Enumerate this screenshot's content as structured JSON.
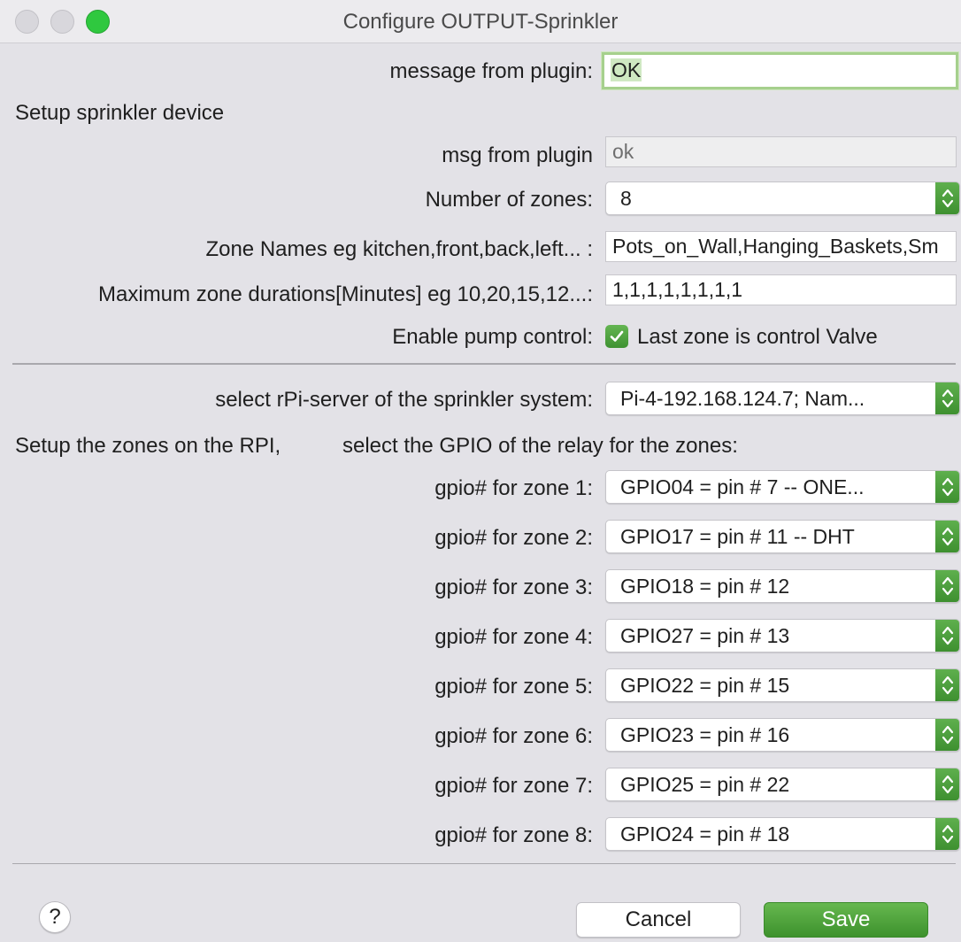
{
  "window": {
    "title": "Configure OUTPUT-Sprinkler"
  },
  "plugin_message": {
    "label": "message from plugin:",
    "value": "OK"
  },
  "setup_device": {
    "heading": "Setup sprinkler device"
  },
  "msg_from_plugin": {
    "label": "msg from plugin",
    "value": "ok"
  },
  "num_zones": {
    "label": "Number of zones:",
    "value": "8"
  },
  "zone_names": {
    "label": "Zone Names eg kitchen,front,back,left... :",
    "value": "Pots_on_Wall,Hanging_Baskets,Sm"
  },
  "max_durations": {
    "label": "Maximum zone durations[Minutes] eg 10,20,15,12...:",
    "value": "1,1,1,1,1,1,1,1"
  },
  "pump_control": {
    "label": "Enable pump control:",
    "checkbox_label": "Last zone is control Valve",
    "checked": true
  },
  "rpi_server": {
    "label": "select rPi-server of the sprinkler system:",
    "value": "Pi-4-192.168.124.7;  Nam..."
  },
  "zones_setup": {
    "heading_left": "Setup the zones on the RPI,",
    "heading_right": "select the GPIO of the relay for the zones:"
  },
  "gpio_zones": [
    {
      "label": "gpio# for zone 1:",
      "value": "GPIO04 = pin  # 7 -- ONE..."
    },
    {
      "label": "gpio# for zone 2:",
      "value": "GPIO17 = pin  # 11 -- DHT"
    },
    {
      "label": "gpio# for zone 3:",
      "value": "GPIO18 = pin  # 12"
    },
    {
      "label": "gpio# for zone 4:",
      "value": "GPIO27 = pin  # 13"
    },
    {
      "label": "gpio# for zone 5:",
      "value": "GPIO22 = pin  # 15"
    },
    {
      "label": "gpio# for zone 6:",
      "value": "GPIO23 = pin  # 16"
    },
    {
      "label": "gpio# for zone 7:",
      "value": "GPIO25 = pin  # 22"
    },
    {
      "label": "gpio# for zone 8:",
      "value": "GPIO24 = pin  # 18"
    }
  ],
  "buttons": {
    "help": "?",
    "cancel": "Cancel",
    "save": "Save"
  },
  "colors": {
    "accent": "#4ea13e",
    "focus_ring": "#a6d08d"
  }
}
